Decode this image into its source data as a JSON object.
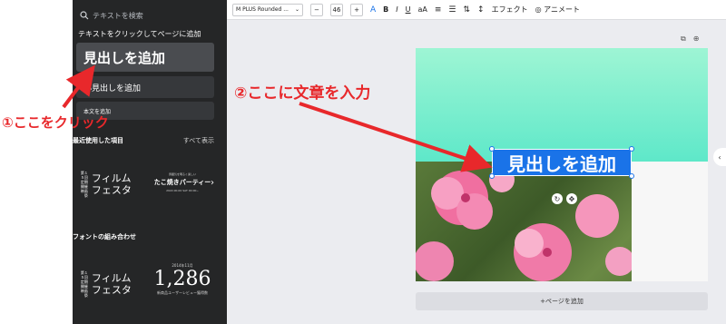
{
  "panel": {
    "search_placeholder": "テキストを検索",
    "section_title": "テキストをクリックしてページに追加",
    "add_heading": "見出しを追加",
    "add_subheading": "小見出しを追加",
    "add_body": "本文を追加",
    "recent_title": "最近使用した項目",
    "see_all": "すべて表示",
    "combo_title": "フォントの組み合わせ",
    "template_film": {
      "small": "第１５回 定期開催 映画祭",
      "big": "フィルム フェスタ"
    },
    "template_party": {
      "top": "雰囲気を明るく楽しい",
      "mid": "たこ焼きパーティー",
      "bot": "2022.00.00 SAT 00:00~"
    },
    "template_number": {
      "date": "2014年11月",
      "num": "1,286",
      "sub": "新商品ユーザーレビュー獲得数"
    }
  },
  "toolbar": {
    "font_name": "M PLUS Rounded ...",
    "minus": "−",
    "size": "46",
    "plus": "+",
    "bold": "B",
    "italic": "I",
    "underline": "U",
    "case": "aA",
    "effects": "エフェクト",
    "animate": "アニメート"
  },
  "canvas": {
    "heading_text": "見出しを追加",
    "add_page": "+ページを追加"
  },
  "annotations": {
    "click_here": "①ここをクリック",
    "type_here": "②ここに文章を入力"
  },
  "colors": {
    "annotation_red": "#e8282b",
    "selection_blue": "#1a73e8",
    "panel_bg": "#252627"
  }
}
